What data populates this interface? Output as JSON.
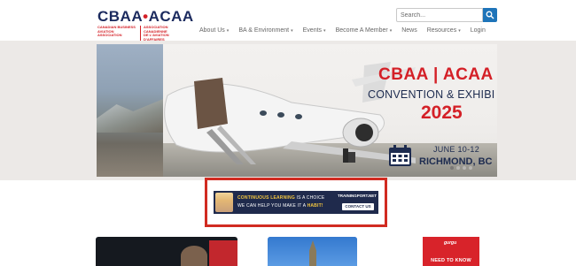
{
  "logo": {
    "name": "CBAA•ACAA",
    "name_left": "CBAA",
    "name_right": "ACAA",
    "subtitle_en": "CANADIAN BUSINESS\nAVIATION ASSOCIATION",
    "subtitle_fr": "ASSOCIATION CANADIENNE\nDE L'AVIATION D'AFFAIRES"
  },
  "search": {
    "placeholder": "Search...",
    "button_icon": "search-icon"
  },
  "nav": {
    "items": [
      {
        "label": "About Us",
        "has_dropdown": true
      },
      {
        "label": "BA & Environment",
        "has_dropdown": true
      },
      {
        "label": "Events",
        "has_dropdown": true
      },
      {
        "label": "Become A Member",
        "has_dropdown": true
      },
      {
        "label": "News",
        "has_dropdown": false
      },
      {
        "label": "Resources",
        "has_dropdown": true
      },
      {
        "label": "Login",
        "has_dropdown": false
      }
    ],
    "dropdown_icon": "chevron-down-icon"
  },
  "hero": {
    "title": "CBAA | ACAA",
    "subtitle": "CONVENTION & EXHIBI",
    "year": "2025",
    "date": "JUNE 10-12",
    "location": "RICHMOND, BC",
    "calendar_icon": "calendar-icon",
    "slide_count": 4,
    "active_slide": 1
  },
  "ad": {
    "line1_highlight": "CONTINUOUS LEARNING",
    "line1_rest": " IS A CHOICE",
    "line2_start": "WE CAN HELP YOU MAKE IT A ",
    "line2_highlight": "HABIT!",
    "brand": "TRAININGPORT.NET",
    "cta": "CONTACT US"
  },
  "cards": {
    "card3_brand": "gurgu",
    "card3_label": "NEED TO KNOW"
  },
  "colors": {
    "brand_navy": "#1b2a5e",
    "brand_red": "#d42027",
    "search_blue": "#1e74b9",
    "ad_highlight_border": "#d12b21"
  }
}
